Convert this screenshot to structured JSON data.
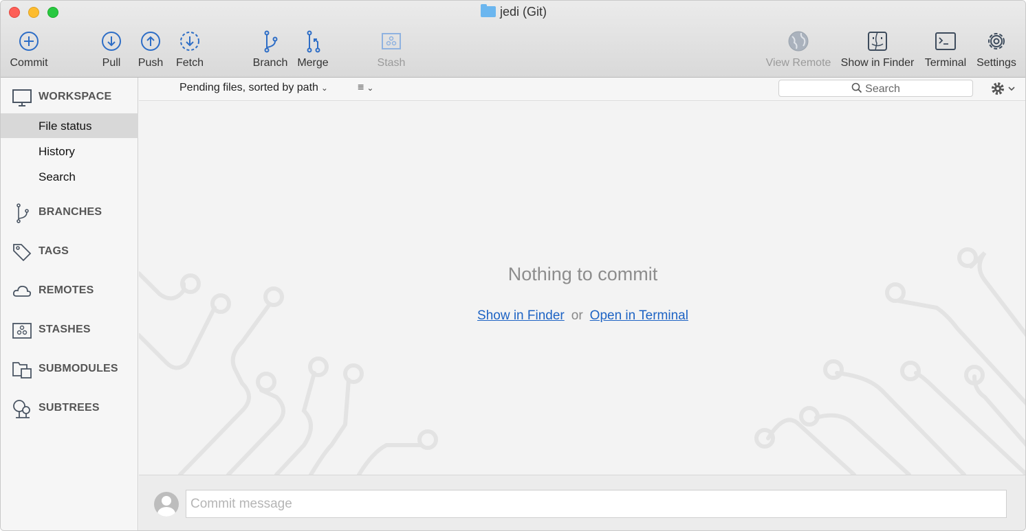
{
  "window": {
    "title": "jedi (Git)"
  },
  "toolbar": {
    "commit": "Commit",
    "pull": "Pull",
    "push": "Push",
    "fetch": "Fetch",
    "branch": "Branch",
    "merge": "Merge",
    "stash": "Stash",
    "view_remote": "View Remote",
    "show_in_finder": "Show in Finder",
    "terminal": "Terminal",
    "settings": "Settings"
  },
  "sidebar": {
    "workspace": "WORKSPACE",
    "file_status": "File status",
    "history": "History",
    "search": "Search",
    "branches": "BRANCHES",
    "tags": "TAGS",
    "remotes": "REMOTES",
    "stashes": "STASHES",
    "submodules": "SUBMODULES",
    "subtrees": "SUBTREES"
  },
  "filterbar": {
    "pending": "Pending files, sorted by path",
    "search_placeholder": "Search"
  },
  "main": {
    "nothing": "Nothing to commit",
    "show_in_finder": "Show in Finder",
    "or": "or",
    "open_in_terminal": "Open in Terminal"
  },
  "commit": {
    "placeholder": "Commit message"
  },
  "colors": {
    "accent": "#1d63c4",
    "icon_blue": "#2d6dc6"
  }
}
